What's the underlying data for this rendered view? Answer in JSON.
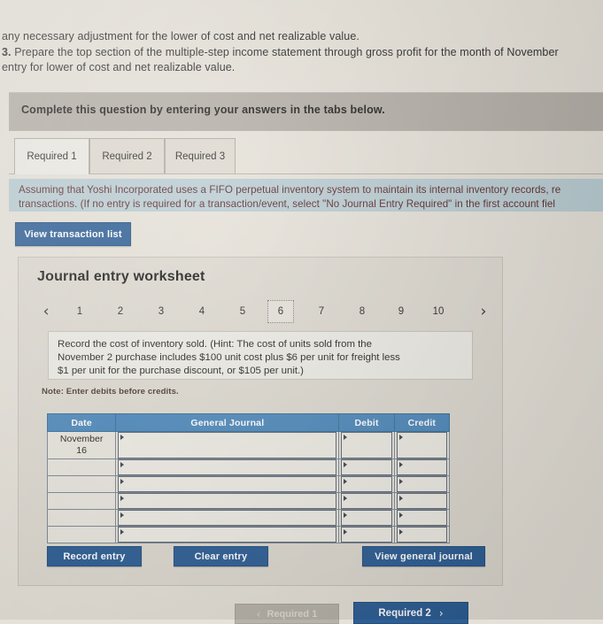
{
  "intro": {
    "line1": "any necessary adjustment for the lower of cost and net realizable value.",
    "line2_num": "3.",
    "line2": " Prepare the top section of the multiple-step income statement through gross profit for the month of November",
    "line3": "entry for lower of cost and net realizable value."
  },
  "instruction_band": {
    "text": "Complete this question by entering your answers in the tabs below."
  },
  "tabs": [
    {
      "label": "Required 1",
      "active": true
    },
    {
      "label": "Required 2",
      "active": false
    },
    {
      "label": "Required 3",
      "active": false
    }
  ],
  "requirement": {
    "line1": "Assuming that Yoshi Incorporated uses a FIFO perpetual inventory system to maintain its internal inventory records, re",
    "line2": "transactions. (If no entry is required for a transaction/event, select \"No Journal Entry Required\" in the first account fiel"
  },
  "view_transaction_button": {
    "label": "View transaction list"
  },
  "worksheet": {
    "title": "Journal entry worksheet",
    "pager": {
      "prev_icon": "chevron-left",
      "next_icon": "chevron-right",
      "prev_glyph": "‹",
      "next_glyph": "›",
      "pages": [
        "1",
        "2",
        "3",
        "4",
        "5",
        "6",
        "7",
        "8",
        "9",
        "10"
      ],
      "current": "6"
    },
    "hint": {
      "line1": "Record the cost of inventory sold. (Hint: The cost of units sold from the",
      "line2": "November 2 purchase includes $100 unit cost plus $6 per unit for freight less",
      "line3": "$1 per unit for the purchase discount, or $105 per unit.)"
    },
    "note": "Note: Enter debits before credits.",
    "table": {
      "headers": [
        "Date",
        "General Journal",
        "Debit",
        "Credit"
      ],
      "rows": [
        {
          "date_line1": "November",
          "date_line2": "16",
          "general_journal": "",
          "debit": "",
          "credit": ""
        },
        {
          "date_line1": "",
          "date_line2": "",
          "general_journal": "",
          "debit": "",
          "credit": ""
        },
        {
          "date_line1": "",
          "date_line2": "",
          "general_journal": "",
          "debit": "",
          "credit": ""
        },
        {
          "date_line1": "",
          "date_line2": "",
          "general_journal": "",
          "debit": "",
          "credit": ""
        },
        {
          "date_line1": "",
          "date_line2": "",
          "general_journal": "",
          "debit": "",
          "credit": ""
        },
        {
          "date_line1": "",
          "date_line2": "",
          "general_journal": "",
          "debit": "",
          "credit": ""
        }
      ]
    },
    "buttons": {
      "record": "Record entry",
      "clear": "Clear entry",
      "view_journal": "View general journal"
    }
  },
  "bottom_nav": {
    "prev_label": "Required 1",
    "prev_glyph": "‹",
    "next_label": "Required 2",
    "next_glyph": "›"
  },
  "colors": {
    "page_background": "#e5e1d8",
    "instruction_band": "#b3aea6",
    "requirement_band": "#b9ccd2",
    "requirement_text": "#5d2b2b",
    "button_blue": "#2d5e95",
    "table_header_blue": "#4d88ba",
    "panel_background": "#ddd9d0",
    "disabled_button": "#b6b2a9"
  }
}
